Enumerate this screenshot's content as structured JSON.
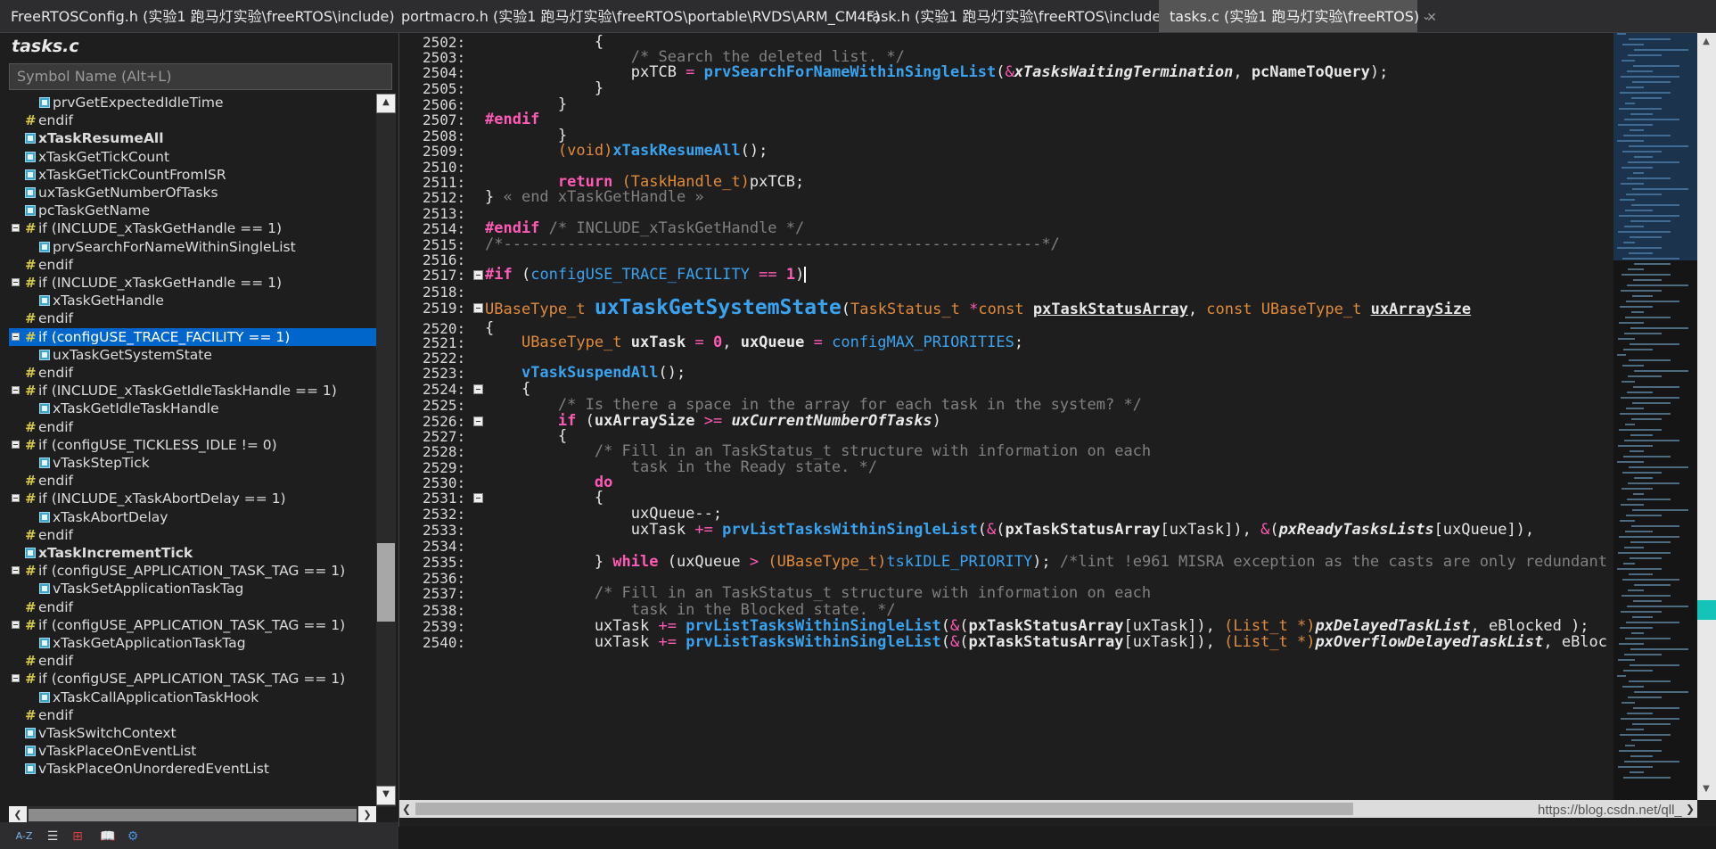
{
  "tabs": [
    {
      "label": "FreeRTOSConfig.h (实验1 跑马灯实验\\freeRTOS\\include)",
      "active": false
    },
    {
      "label": "portmacro.h (实验1 跑马灯实验\\freeRTOS\\portable\\RVDS\\ARM_CM4F)",
      "active": false
    },
    {
      "label": "task.h (实验1 跑马灯实验\\freeRTOS\\include)",
      "active": false
    },
    {
      "label": "tasks.c (实验1 跑马灯实验\\freeRTOS)",
      "active": true,
      "close": "✕"
    }
  ],
  "tab_overflow": "⌄",
  "sidebar": {
    "title": "tasks.c",
    "search_placeholder": "Symbol Name (Alt+L)",
    "items": [
      {
        "label": "prvGetExpectedIdleTime",
        "icon": "function-icon",
        "indent": 2
      },
      {
        "label": "endif",
        "icon": "hash-icon",
        "indent": 1
      },
      {
        "label": "xTaskResumeAll",
        "icon": "function-icon",
        "indent": 1,
        "bold": true
      },
      {
        "label": "xTaskGetTickCount",
        "icon": "function-icon",
        "indent": 1
      },
      {
        "label": "xTaskGetTickCountFromISR",
        "icon": "function-icon",
        "indent": 1
      },
      {
        "label": "uxTaskGetNumberOfTasks",
        "icon": "function-icon",
        "indent": 1
      },
      {
        "label": "pcTaskGetName",
        "icon": "function-icon",
        "indent": 1
      },
      {
        "label": "if (INCLUDE_xTaskGetHandle == 1)",
        "icon": "hash-icon",
        "indent": 1,
        "fold": true
      },
      {
        "label": "prvSearchForNameWithinSingleList",
        "icon": "function-icon",
        "indent": 2
      },
      {
        "label": "endif",
        "icon": "hash-icon",
        "indent": 1
      },
      {
        "label": "if (INCLUDE_xTaskGetHandle == 1)",
        "icon": "hash-icon",
        "indent": 1,
        "fold": true
      },
      {
        "label": "xTaskGetHandle",
        "icon": "function-icon",
        "indent": 2
      },
      {
        "label": "endif",
        "icon": "hash-icon",
        "indent": 1
      },
      {
        "label": "if (configUSE_TRACE_FACILITY == 1)",
        "icon": "hash-icon",
        "indent": 1,
        "fold": true,
        "selected": true
      },
      {
        "label": "uxTaskGetSystemState",
        "icon": "function-icon",
        "indent": 2
      },
      {
        "label": "endif",
        "icon": "hash-icon",
        "indent": 1
      },
      {
        "label": "if (INCLUDE_xTaskGetIdleTaskHandle == 1)",
        "icon": "hash-icon",
        "indent": 1,
        "fold": true
      },
      {
        "label": "xTaskGetIdleTaskHandle",
        "icon": "function-icon",
        "indent": 2
      },
      {
        "label": "endif",
        "icon": "hash-icon",
        "indent": 1
      },
      {
        "label": "if (configUSE_TICKLESS_IDLE != 0)",
        "icon": "hash-icon",
        "indent": 1,
        "fold": true
      },
      {
        "label": "vTaskStepTick",
        "icon": "function-icon",
        "indent": 2
      },
      {
        "label": "endif",
        "icon": "hash-icon",
        "indent": 1
      },
      {
        "label": "if (INCLUDE_xTaskAbortDelay == 1)",
        "icon": "hash-icon",
        "indent": 1,
        "fold": true
      },
      {
        "label": "xTaskAbortDelay",
        "icon": "function-icon",
        "indent": 2
      },
      {
        "label": "endif",
        "icon": "hash-icon",
        "indent": 1
      },
      {
        "label": "xTaskIncrementTick",
        "icon": "function-icon",
        "indent": 1,
        "bold": true
      },
      {
        "label": "if (configUSE_APPLICATION_TASK_TAG == 1)",
        "icon": "hash-icon",
        "indent": 1,
        "fold": true
      },
      {
        "label": "vTaskSetApplicationTaskTag",
        "icon": "function-icon",
        "indent": 2
      },
      {
        "label": "endif",
        "icon": "hash-icon",
        "indent": 1
      },
      {
        "label": "if (configUSE_APPLICATION_TASK_TAG == 1)",
        "icon": "hash-icon",
        "indent": 1,
        "fold": true
      },
      {
        "label": "xTaskGetApplicationTaskTag",
        "icon": "function-icon",
        "indent": 2
      },
      {
        "label": "endif",
        "icon": "hash-icon",
        "indent": 1
      },
      {
        "label": "if (configUSE_APPLICATION_TASK_TAG == 1)",
        "icon": "hash-icon",
        "indent": 1,
        "fold": true
      },
      {
        "label": "xTaskCallApplicationTaskHook",
        "icon": "function-icon",
        "indent": 2
      },
      {
        "label": "endif",
        "icon": "hash-icon",
        "indent": 1
      },
      {
        "label": "vTaskSwitchContext",
        "icon": "function-icon",
        "indent": 1
      },
      {
        "label": "vTaskPlaceOnEventList",
        "icon": "function-icon",
        "indent": 1
      },
      {
        "label": "vTaskPlaceOnUnorderedEventList",
        "icon": "function-icon",
        "indent": 1
      }
    ],
    "toolbar": {
      "sort_az": "A-Z",
      "list_view": "☰",
      "tree_view": "⊞",
      "book": "📖",
      "settings": "⚙"
    }
  },
  "editor": {
    "lines": [
      {
        "n": "2502:",
        "html": "            {"
      },
      {
        "n": "2503:",
        "html": "                <span class='cm'>/* Search the deleted list. */</span>"
      },
      {
        "n": "2504:",
        "html": "                pxTCB <span class='op'>=</span> <span class='fn'>prvSearchForNameWithinSingleList</span>(<span class='op'>&amp;</span><span class='gv'>xTasksWaitingTermination</span>, <span class='var'>pcNameToQuery</span>);"
      },
      {
        "n": "2505:",
        "html": "            }"
      },
      {
        "n": "2506:",
        "html": "        }"
      },
      {
        "n": "2507:",
        "html": "<span class='pp'>#endif</span>"
      },
      {
        "n": "2508:",
        "html": "        }"
      },
      {
        "n": "2509:",
        "html": "        <span class='ty'>(void)</span><span class='fn'>xTaskResumeAll</span>();"
      },
      {
        "n": "2510:",
        "html": ""
      },
      {
        "n": "2511:",
        "html": "        <span class='kw'>return</span> <span class='ty'>(TaskHandle_t)</span>pxTCB;"
      },
      {
        "n": "2512:",
        "html": "} <span class='cm'>« end xTaskGetHandle »</span>"
      },
      {
        "n": "2513:",
        "html": ""
      },
      {
        "n": "2514:",
        "html": "<span class='pp'>#endif</span> <span class='cm'>/* INCLUDE_xTaskGetHandle */</span>"
      },
      {
        "n": "2515:",
        "html": "<span class='cm'>/*-----------------------------------------------------------*/</span>"
      },
      {
        "n": "2516:",
        "html": ""
      },
      {
        "n": "2517:",
        "html": "<span class='pp'>#if</span> (<span class='mac'>configUSE_TRACE_FACILITY</span> <span class='op'>==</span> <span class='num'>1</span>)<span class='cursor'></span>",
        "fold": true
      },
      {
        "n": "2518:",
        "html": ""
      },
      {
        "n": "2519:",
        "html": "<span class='ty'>UBaseType_t</span> <span class='fnbig'>uxTaskGetSystemState</span>(<span class='ty'>TaskStatus_t</span> <span class='op'>*</span><span class='ty'>const</span> <span class='par'>pxTaskStatusArray</span>, <span class='ty'>const</span> <span class='ty'>UBaseType_t</span> <span class='par'>uxArraySize</span>",
        "fold": true,
        "big": true
      },
      {
        "n": "2520:",
        "html": "{"
      },
      {
        "n": "2521:",
        "html": "    <span class='ty'>UBaseType_t</span> <span class='var'>uxTask</span> <span class='op'>=</span> <span class='num'>0</span>, <span class='var'>uxQueue</span> <span class='op'>=</span> <span class='mac'>configMAX_PRIORITIES</span>;"
      },
      {
        "n": "2522:",
        "html": ""
      },
      {
        "n": "2523:",
        "html": "    <span class='fn'>vTaskSuspendAll</span>();"
      },
      {
        "n": "2524:",
        "html": "    {",
        "fold": true
      },
      {
        "n": "2525:",
        "html": "        <span class='cm'>/* Is there a space in the array for each task in the system? */</span>"
      },
      {
        "n": "2526:",
        "html": "        <span class='kw'>if</span> (<span class='var'>uxArraySize</span> <span class='op'>&gt;=</span> <span class='gv'>uxCurrentNumberOfTasks</span>)",
        "fold": true
      },
      {
        "n": "2527:",
        "html": "        {"
      },
      {
        "n": "2528:",
        "html": "            <span class='cm'>/* Fill in an TaskStatus_t structure with information on each</span>"
      },
      {
        "n": "2529:",
        "html": "            <span class='cm'>    task in the Ready state. */</span>"
      },
      {
        "n": "2530:",
        "html": "            <span class='kw'>do</span>"
      },
      {
        "n": "2531:",
        "html": "            {",
        "fold": true
      },
      {
        "n": "2532:",
        "html": "                uxQueue--;"
      },
      {
        "n": "2533:",
        "html": "                uxTask <span class='op'>+=</span> <span class='fn'>prvListTasksWithinSingleList</span>(<span class='op'>&amp;</span>(<span class='var'>pxTaskStatusArray</span>[uxTask]), <span class='op'>&amp;</span>(<span class='gv'>pxReadyTasksLists</span>[uxQueue]),"
      },
      {
        "n": "2534:",
        "html": ""
      },
      {
        "n": "2535:",
        "html": "            } <span class='kw'>while</span> (uxQueue <span class='op'>&gt;</span> <span class='ty'>(UBaseType_t)</span><span class='mac'>tskIDLE_PRIORITY</span>); <span class='cm'>/*lint !e961 MISRA exception as the casts are only redundant</span>"
      },
      {
        "n": "2536:",
        "html": ""
      },
      {
        "n": "2537:",
        "html": "            <span class='cm'>/* Fill in an TaskStatus_t structure with information on each</span>"
      },
      {
        "n": "2538:",
        "html": "            <span class='cm'>    task in the Blocked state. */</span>"
      },
      {
        "n": "2539:",
        "html": "            uxTask <span class='op'>+=</span> <span class='fn'>prvListTasksWithinSingleList</span>(<span class='op'>&amp;</span>(<span class='var'>pxTaskStatusArray</span>[uxTask]), <span class='ty'>(List_t *)</span><span class='gv'>pxDelayedTaskList</span>, eBlocked );"
      },
      {
        "n": "2540:",
        "html": "            uxTask <span class='op'>+=</span> <span class='fn'>prvListTasksWithinSingleList</span>(<span class='op'>&amp;</span>(<span class='var'>pxTaskStatusArray</span>[uxTask]), <span class='ty'>(List_t *)</span><span class='gv'>pxOverflowDelayedTaskList</span>, eBlocked );"
      }
    ]
  },
  "scroll": {
    "left_arrow": "❮",
    "right_arrow": "❯",
    "up_arrow": "▲",
    "down_arrow": "▼"
  },
  "watermark": "https://blog.csdn.net/qll_"
}
